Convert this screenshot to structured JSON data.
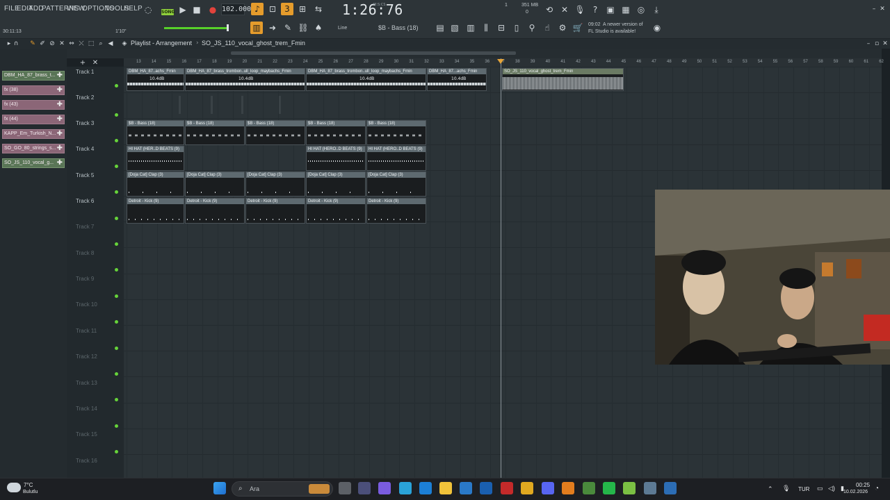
{
  "menu": [
    "FILE",
    "EDIT",
    "ADD",
    "PATTERNS",
    "VIEW",
    "OPTIONS",
    "TOOLS",
    "HELP"
  ],
  "transport": {
    "mode_badge": "SONG",
    "tempo": "102.000",
    "time": "1:26:76",
    "time_label": "M:S:CS",
    "memory": "351 MB",
    "cpu_top": "1",
    "cpu_bottom": "0",
    "hint_time": "30:11:13",
    "snap_label": "1'10\"",
    "tool_line": "Line",
    "pattern_select": "$B - Bass (18)"
  },
  "notification": {
    "time": "09:02",
    "line1": "A newer version of",
    "line2": "FL Studio is available!"
  },
  "playlist": {
    "title": "Playlist - Arrangement",
    "separator": "›",
    "pattern": "SO_JS_110_vocal_ghost_trem_Fmin"
  },
  "picker": [
    {
      "label": "DBM_HA_87_brass_t...",
      "type": "audio"
    },
    {
      "label": "fx (38)",
      "type": "pattern"
    },
    {
      "label": "fx (43)",
      "type": "pattern"
    },
    {
      "label": "fx (44)",
      "type": "pattern"
    },
    {
      "label": "KAPP_Em_Turkish_N...",
      "type": "pattern"
    },
    {
      "label": "SO_GO_80_strings_s...",
      "type": "pattern"
    },
    {
      "label": "SO_JS_110_vocal_g...",
      "type": "audio"
    }
  ],
  "tracks": [
    "Track 1",
    "Track 2",
    "Track 3",
    "Track 4",
    "Track 5",
    "Track 6",
    "Track 7",
    "Track 8",
    "Track 9",
    "Track 10",
    "Track 11",
    "Track 12",
    "Track 13",
    "Track 14",
    "Track 15",
    "Track 16"
  ],
  "ruler": [
    "13",
    "14",
    "15",
    "16",
    "17",
    "18",
    "19",
    "20",
    "21",
    "22",
    "23",
    "24",
    "25",
    "26",
    "27",
    "28",
    "29",
    "30",
    "31",
    "32",
    "33",
    "34",
    "35",
    "36",
    "37",
    "38",
    "39",
    "40",
    "41",
    "42",
    "43",
    "44",
    "45",
    "46",
    "47",
    "48",
    "49",
    "50",
    "51",
    "52",
    "53",
    "54",
    "55",
    "56",
    "57",
    "58",
    "59",
    "60",
    "61",
    "62"
  ],
  "clips": {
    "track1": [
      {
        "label": "DBM_HA_87..achs_Fmin",
        "db": "10.4dB"
      },
      {
        "label": "DBM_HA_87_brass_trombon..ull_loop_maybachs_Fmin",
        "db": "10.4dB"
      },
      {
        "label": "DBM_HA_87_brass_trombon..ull_loop_maybachs_Fmin",
        "db": "10.4dB"
      },
      {
        "label": "DBM_HA_87...achs_Fmin",
        "db": "10.4dB"
      },
      {
        "label": "SO_JS_110_vocal_ghost_trem_Fmin",
        "db": ""
      }
    ],
    "track3": [
      "$B - Bass (18)",
      "$B - Bass (18)",
      "$B - Bass (18)",
      "$B - Bass (18)",
      "$B - Bass (18)"
    ],
    "track4": [
      "HI HAT (HER..D BEATS (9)",
      "HI HAT (HERO..D BEATS (9)",
      "HI HAT (HERO..D BEATS (9)"
    ],
    "track5": [
      "[Doja Cat] Clap (3)",
      "[Doja Cat] Clap (3)",
      "[Doja Cat] Clap (3)",
      "[Doja Cat] Clap (3)",
      "[Doja Cat] Clap (3)"
    ],
    "track6": [
      "Detroit - Kick (9)",
      "Detroit - Kick (9)",
      "Detroit - Kick (9)",
      "Detroit - Kick (9)",
      "Detroit - Kick (9)"
    ]
  },
  "taskbar": {
    "weather_temp": "7°C",
    "weather_desc": "Bulutlu",
    "search_placeholder": "Ara",
    "lang": "TUR",
    "clock_time": "00:25",
    "clock_date": "10.02.2026"
  },
  "colors": {
    "accent_orange": "#e59c2c",
    "accent_green": "#66d33a",
    "pattern_clip": "#8b6677",
    "audio_clip": "#597556"
  }
}
